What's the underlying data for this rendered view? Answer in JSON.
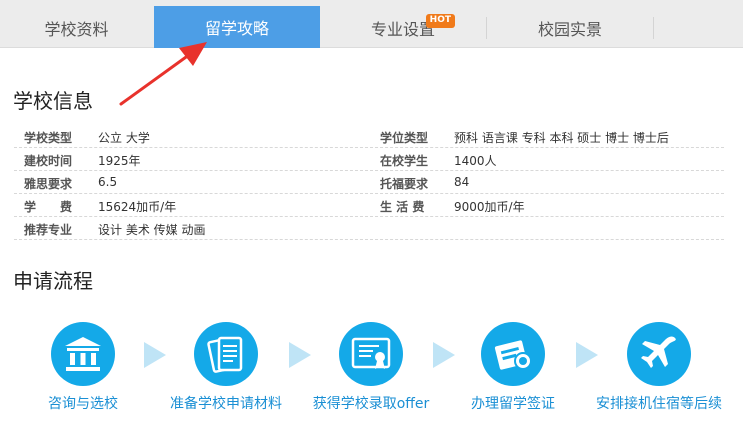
{
  "tabs": [
    {
      "label": "学校资料",
      "active": false
    },
    {
      "label": "留学攻略",
      "active": true
    },
    {
      "label": "专业设置",
      "active": false,
      "badge": "HOT"
    },
    {
      "label": "校园实景",
      "active": false
    }
  ],
  "school_info": {
    "title": "学校信息",
    "rows": [
      {
        "label1": "学校类型",
        "value1": "公立 大学",
        "label2": "学位类型",
        "value2": "预科 语言课 专科 本科 硕士 博士 博士后"
      },
      {
        "label1": "建校时间",
        "value1": "1925年",
        "label2": "在校学生",
        "value2": "1400人"
      },
      {
        "label1": "雅思要求",
        "value1": "6.5",
        "label2": "托福要求",
        "value2": "84"
      },
      {
        "label1": "学　　费",
        "value1": "15624加币/年",
        "label2": "生 活 费",
        "value2": "9000加币/年"
      },
      {
        "label1": "推荐专业",
        "value1": "设计 美术 传媒 动画",
        "label2": "",
        "value2": ""
      }
    ]
  },
  "process": {
    "title": "申请流程",
    "steps": [
      {
        "label": "咨询与选校",
        "icon": "school-building-icon"
      },
      {
        "label": "准备学校申请材料",
        "icon": "documents-icon"
      },
      {
        "label": "获得学校录取offer",
        "icon": "certificate-icon"
      },
      {
        "label": "办理留学签证",
        "icon": "passport-book-icon"
      },
      {
        "label": "安排接机住宿等后续",
        "icon": "airplane-icon"
      }
    ]
  },
  "colors": {
    "active_tab": "#4d9ee6",
    "hot_badge": "#f07a1a",
    "step_circle": "#14a9e8",
    "step_label": "#1a8fd4",
    "step_arrow": "#bfe4f6",
    "pointer_arrow": "#e8322c"
  }
}
